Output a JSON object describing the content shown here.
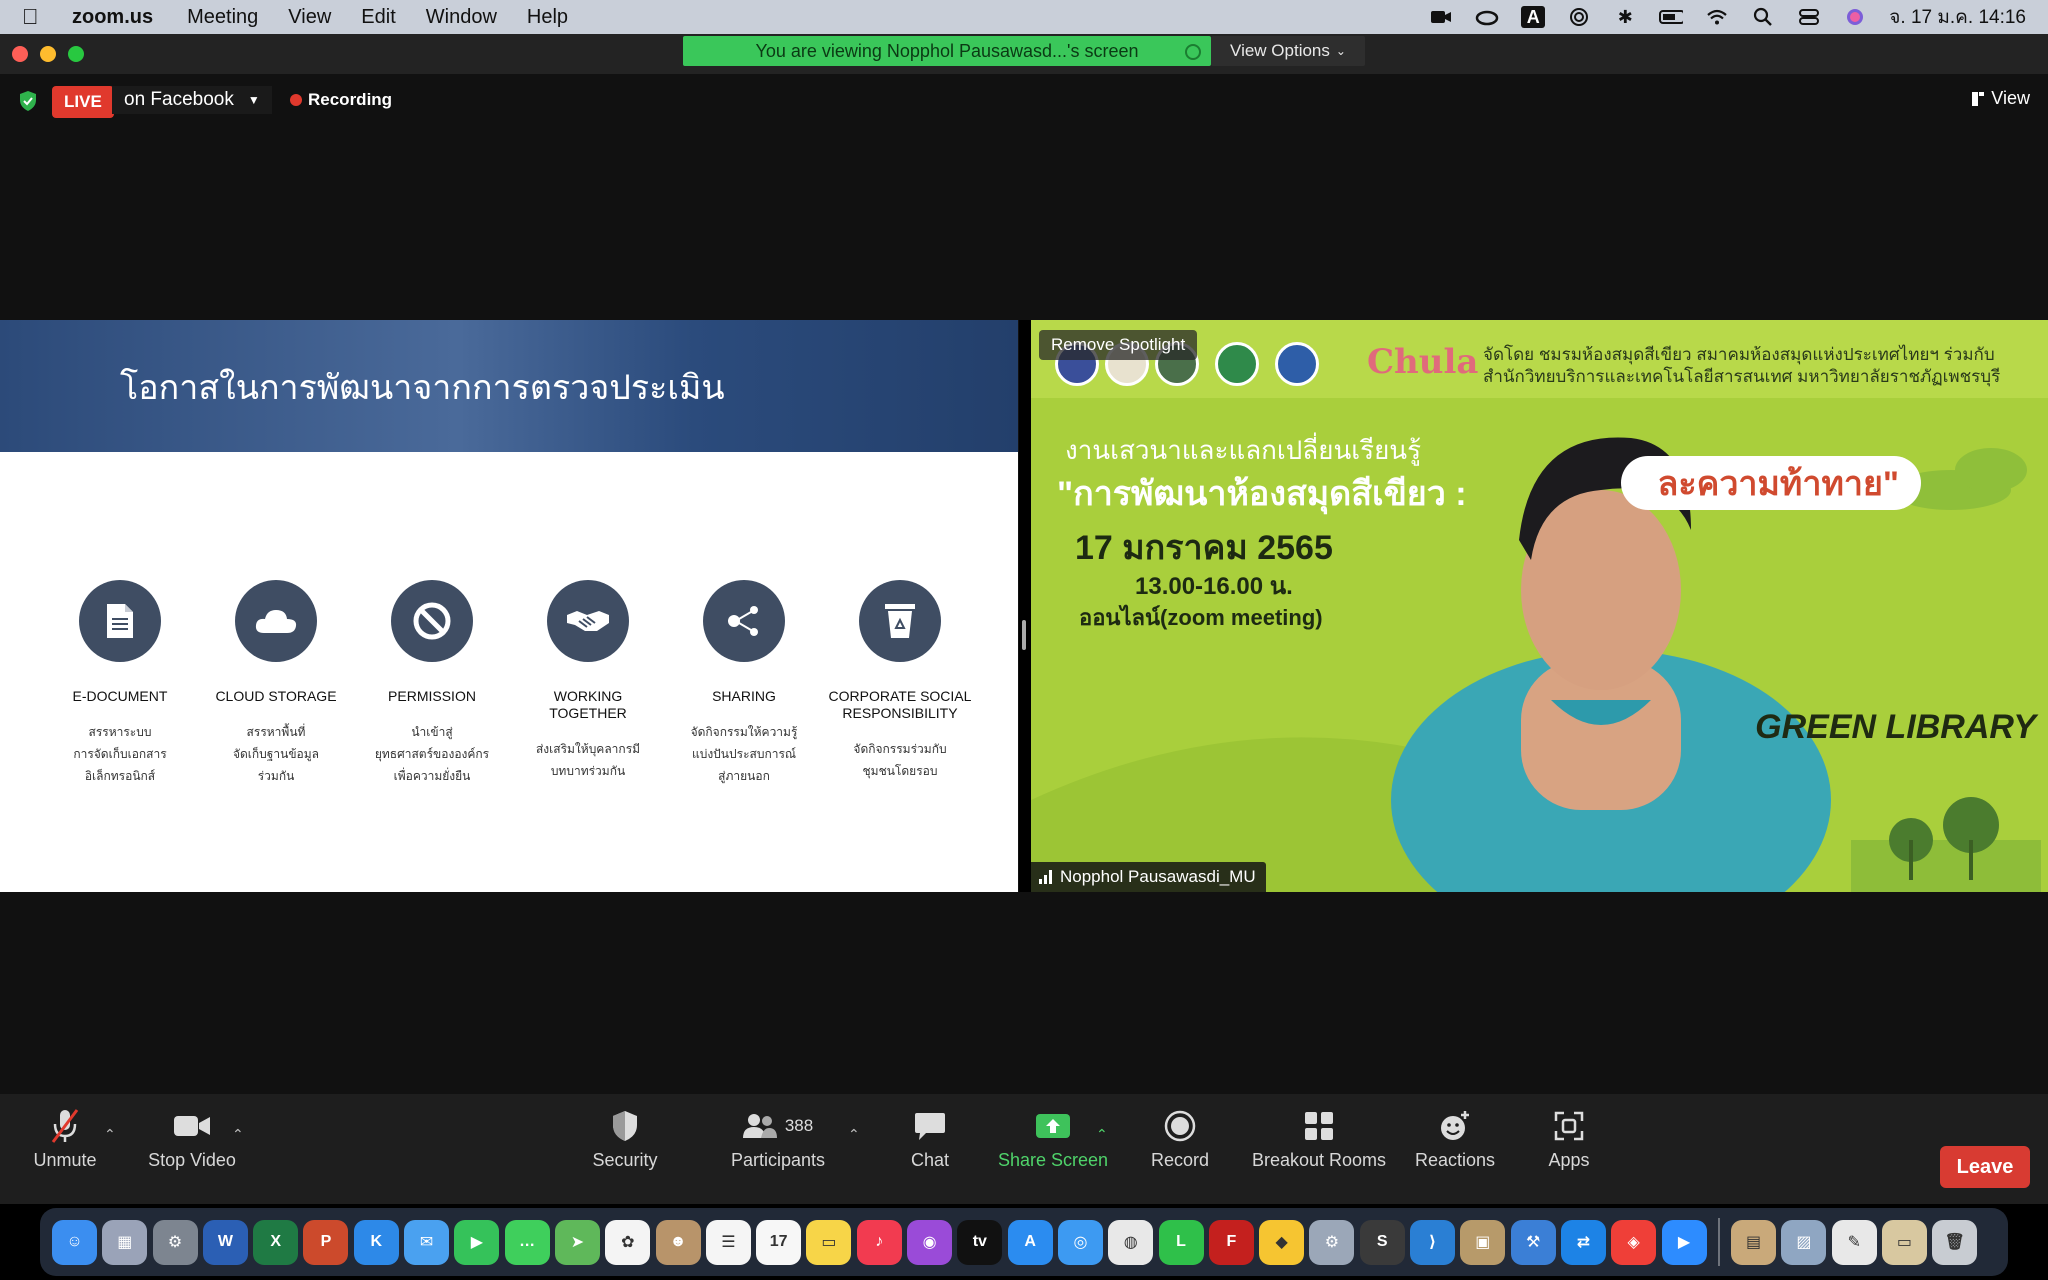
{
  "menubar": {
    "app_name": "zoom.us",
    "menus": [
      "Meeting",
      "View",
      "Edit",
      "Window",
      "Help"
    ],
    "status_icons": [
      "zoom-video-icon",
      "creative-cloud-icon",
      "input-source-icon",
      "airdrop-icon",
      "bluetooth-icon",
      "battery-icon",
      "wifi-icon",
      "spotlight-search-icon",
      "control-center-icon",
      "siri-icon"
    ],
    "input_source_label": "A",
    "clock": "จ. 17 ม.ค.  14:16"
  },
  "window": {
    "viewing_banner": "You are viewing Nopphol Pausawasd...'s screen",
    "view_options": "View Options",
    "live_badge": "LIVE",
    "live_target": "on Facebook",
    "recording": "Recording",
    "view_button": "View"
  },
  "slide": {
    "title": "โอกาสในการพัฒนาจากการตรวจประเมิน",
    "features": [
      {
        "name": "E-DOCUMENT",
        "desc": "สรรหาระบบ\nการจัดเก็บเอกสาร\nอิเล็กทรอนิกส์",
        "icon": "document-icon"
      },
      {
        "name": "CLOUD STORAGE",
        "desc": "สรรหาพื้นที่\nจัดเก็บฐานข้อมูล\nร่วมกัน",
        "icon": "cloud-icon"
      },
      {
        "name": "PERMISSION",
        "desc": "นำเข้าสู่\nยุทธศาสตร์ขององค์กร\nเพื่อความยั่งยืน",
        "icon": "prohibited-icon"
      },
      {
        "name": "WORKING\nTOGETHER",
        "desc": "ส่งเสริมให้บุคลากรมี\nบทบาทร่วมกัน",
        "icon": "handshake-icon"
      },
      {
        "name": "SHARING",
        "desc": "จัดกิจกรรมให้ความรู้\nแบ่งปันประสบการณ์\nสู่ภายนอก",
        "icon": "share-icon"
      },
      {
        "name": "CORPORATE SOCIAL\nRESPONSIBILITY",
        "desc": "จัดกิจกรรมร่วมกับ\nชุมชนโดยรอบ",
        "icon": "recycle-bin-icon"
      }
    ]
  },
  "video": {
    "remove_spotlight": "Remove Spotlight",
    "chula": "Chula",
    "organizer_line1": "จัดโดย ชมรมห้องสมุดสีเขียว สมาคมห้องสมุดแห่งประเทศไทยฯ ร่วมกับ",
    "organizer_line2": "สำนักวิทยบริการและเทคโนโลยีสารสนเทศ มหาวิทยาลัยราชภัฏเพชรบุรี",
    "event_line": "งานเสวนาและแลกเปลี่ยนเรียนรู้",
    "event_title": "\"การพัฒนาห้องสมุดสีเขียว :",
    "event_banner": "ละความท้าทาย\"",
    "event_date": "17 มกราคม 2565",
    "event_time": "13.00-16.00 น.",
    "event_mode": "ออนไลน์(zoom meeting)",
    "green_library": "GREEN LIBRARY",
    "participant_name": "Nopphol Pausawasdi_MU"
  },
  "toolbar": {
    "unmute": "Unmute",
    "stop_video": "Stop Video",
    "security": "Security",
    "participants": "Participants",
    "participants_count": "388",
    "chat": "Chat",
    "share_screen": "Share Screen",
    "record": "Record",
    "breakout_rooms": "Breakout Rooms",
    "reactions": "Reactions",
    "apps": "Apps",
    "leave": "Leave"
  },
  "dock": {
    "apps": [
      {
        "name": "finder",
        "color": "#3b8ef0",
        "glyph": "☺"
      },
      {
        "name": "launchpad",
        "color": "#9aa3b8",
        "glyph": "▦"
      },
      {
        "name": "system-preferences",
        "color": "#7d8590",
        "glyph": "⚙"
      },
      {
        "name": "word",
        "color": "#2b5fb4",
        "glyph": "W"
      },
      {
        "name": "excel",
        "color": "#1f7a44",
        "glyph": "X"
      },
      {
        "name": "powerpoint",
        "color": "#cc4a2c",
        "glyph": "P"
      },
      {
        "name": "keynote",
        "color": "#2d89e8",
        "glyph": "K"
      },
      {
        "name": "mail",
        "color": "#4aa1f0",
        "glyph": "✉"
      },
      {
        "name": "facetime",
        "color": "#35c25a",
        "glyph": "▶"
      },
      {
        "name": "messages",
        "color": "#3fcf5c",
        "glyph": "…"
      },
      {
        "name": "maps",
        "color": "#5fb85a",
        "glyph": "➤"
      },
      {
        "name": "photos",
        "color": "#f4f4f4",
        "glyph": "✿"
      },
      {
        "name": "contacts",
        "color": "#b8946a",
        "glyph": "☻"
      },
      {
        "name": "reminders",
        "color": "#f5f5f5",
        "glyph": "☰"
      },
      {
        "name": "calendar",
        "color": "#f7f7f7",
        "glyph": "17"
      },
      {
        "name": "notes",
        "color": "#f7d548",
        "glyph": "▭"
      },
      {
        "name": "music",
        "color": "#f23b50",
        "glyph": "♪"
      },
      {
        "name": "podcasts",
        "color": "#9a4bd8",
        "glyph": "◉"
      },
      {
        "name": "apple-tv",
        "color": "#111111",
        "glyph": "tv"
      },
      {
        "name": "app-store",
        "color": "#2b8cf0",
        "glyph": "A"
      },
      {
        "name": "safari",
        "color": "#3d9af2",
        "glyph": "◎"
      },
      {
        "name": "chrome",
        "color": "#e8e8e8",
        "glyph": "◍"
      },
      {
        "name": "line",
        "color": "#2fc04a",
        "glyph": "L"
      },
      {
        "name": "filezilla",
        "color": "#c4201e",
        "glyph": "F"
      },
      {
        "name": "cyberduck",
        "color": "#f6c531",
        "glyph": "◆"
      },
      {
        "name": "utility",
        "color": "#9ba7b8",
        "glyph": "⚙"
      },
      {
        "name": "sublime-text",
        "color": "#3a3a3a",
        "glyph": "S"
      },
      {
        "name": "vscode",
        "color": "#2a7fd4",
        "glyph": "⟩"
      },
      {
        "name": "archive-utility",
        "color": "#b79a6a",
        "glyph": "▣"
      },
      {
        "name": "xcode",
        "color": "#3b7fd6",
        "glyph": "⚒"
      },
      {
        "name": "teamviewer",
        "color": "#1d83e6",
        "glyph": "⇄"
      },
      {
        "name": "anydesk",
        "color": "#ef3f38",
        "glyph": "◈"
      },
      {
        "name": "zoom",
        "color": "#2d8cff",
        "glyph": "▶"
      },
      {
        "name": "downloads-folder",
        "color": "#c9a97a",
        "glyph": "▤"
      },
      {
        "name": "screenshots",
        "color": "#8fa6c2",
        "glyph": "▨"
      },
      {
        "name": "document",
        "color": "#e8e8e8",
        "glyph": "✎"
      },
      {
        "name": "finder-window",
        "color": "#d8c8a0",
        "glyph": "▭"
      },
      {
        "name": "trash",
        "color": "#c8ccd2",
        "glyph": "🗑"
      }
    ]
  }
}
